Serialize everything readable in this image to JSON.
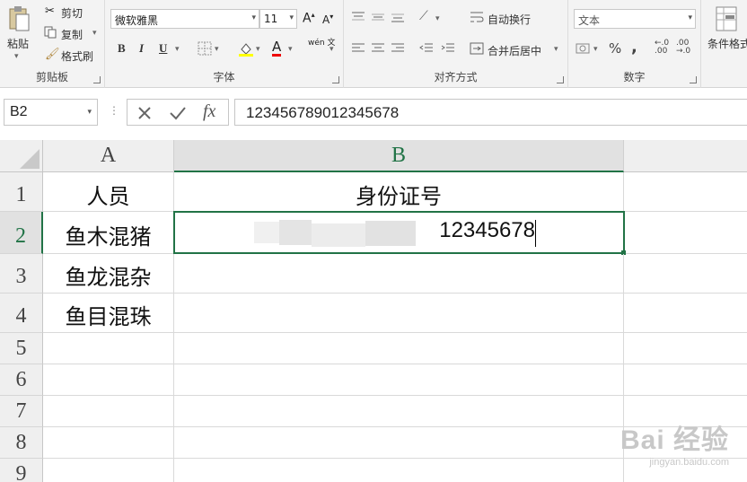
{
  "ribbon": {
    "clipboard": {
      "paste": "粘贴",
      "cut": "剪切",
      "copy": "复制",
      "format_painter": "格式刷",
      "group_label": "剪贴板"
    },
    "font": {
      "font_name": "微软雅黑",
      "font_size": "11",
      "bold": "B",
      "italic": "I",
      "underline": "U",
      "font_color_label": "A",
      "phonetic": "wén 文",
      "group_label": "字体"
    },
    "alignment": {
      "wrap_text": "自动换行",
      "merge_center": "合并后居中",
      "group_label": "对齐方式"
    },
    "number": {
      "format": "文本",
      "percent": "%",
      "comma": ",",
      "group_label": "数字"
    },
    "styles": {
      "conditional_format": "条件格式"
    }
  },
  "formula_bar": {
    "name_box": "B2",
    "fx": "fx",
    "content": "123456789012345678"
  },
  "sheet": {
    "columns": [
      "A",
      "B"
    ],
    "rows": [
      "1",
      "2",
      "3",
      "4",
      "5",
      "6",
      "7",
      "8",
      "9"
    ],
    "cells": {
      "A1": "人员",
      "B1": "身份证号",
      "A2": "鱼木混猪",
      "B2": "12345678",
      "A3": "鱼龙混杂",
      "A4": "鱼目混珠"
    },
    "accent_color": "#217346"
  },
  "watermark": {
    "text": "Bai 经验",
    "url": "jingyan.baidu.com"
  }
}
